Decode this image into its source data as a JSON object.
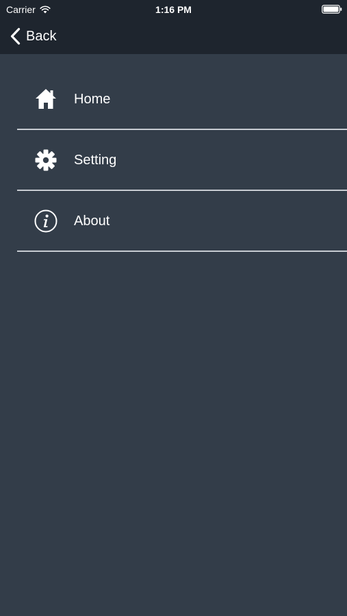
{
  "status_bar": {
    "carrier": "Carrier",
    "time": "1:16 PM",
    "wifi_icon": "wifi-icon",
    "battery_icon": "battery-icon"
  },
  "nav": {
    "back_label": "Back",
    "back_icon": "chevron-left-icon"
  },
  "menu": {
    "items": [
      {
        "label": "Home",
        "icon": "home-icon"
      },
      {
        "label": "Setting",
        "icon": "gear-icon"
      },
      {
        "label": "About",
        "icon": "info-icon"
      }
    ]
  },
  "colors": {
    "background": "#333d49",
    "top_bar": "#1e252e",
    "divider": "#c8ccd2",
    "text": "#ffffff"
  }
}
